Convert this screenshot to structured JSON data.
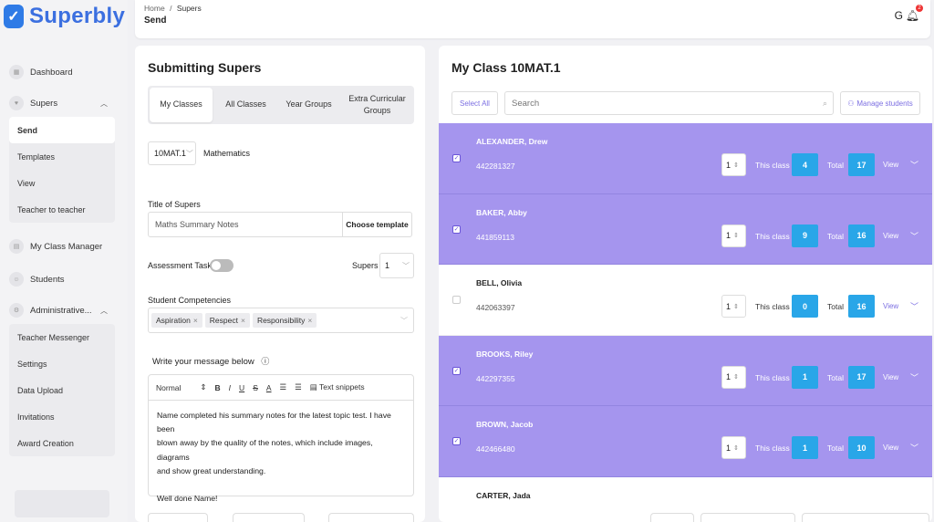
{
  "app": {
    "logo_text": "Superbly",
    "logo_mark": "✓"
  },
  "sidebar": {
    "items": [
      {
        "label": "Dashboard",
        "icon": "dashboard-icon"
      },
      {
        "label": "Supers",
        "icon": "heart-icon"
      },
      {
        "label": "My Class Manager",
        "icon": "clipboard-icon"
      },
      {
        "label": "Students",
        "icon": "users-icon"
      },
      {
        "label": "Administrative...",
        "icon": "gear-icon"
      }
    ],
    "supers_sub": [
      "Send",
      "Templates",
      "View",
      "Teacher to teacher"
    ],
    "admin_sub": [
      "Teacher Messenger",
      "Settings",
      "Data Upload",
      "Invitations",
      "Award Creation"
    ]
  },
  "header": {
    "breadcrumb_home": "Home",
    "breadcrumb_sep": "/",
    "breadcrumb_current": "Supers",
    "title": "Send",
    "notification_count": "2"
  },
  "submit": {
    "title": "Submitting Supers",
    "tabs": [
      "My Classes",
      "All Classes",
      "Year Groups",
      "Extra Curricular Groups"
    ],
    "class_value": "10MAT.1",
    "subject": "Mathematics",
    "title_label": "Title of Supers",
    "title_value": "Maths Summary Notes",
    "choose_template": "Choose template",
    "assessment_label": "Assessment Task",
    "supers_label": "Supers",
    "supers_value": "1",
    "competencies_label": "Student Competencies",
    "competencies": [
      "Aspiration",
      "Respect",
      "Responsibility"
    ],
    "message_label": "Write your message below",
    "toolbar": {
      "format": "Normal",
      "snippets": "Text snippets"
    },
    "message_lines": [
      "Name completed his summary notes for the latest topic test. I have been",
      "blown away by the quality of the notes, which include images, diagrams",
      "and show great understanding.",
      "",
      "Well done Name!"
    ]
  },
  "class_panel": {
    "title": "My Class 10MAT.1",
    "select_all": "Select All",
    "search_placeholder": "Search",
    "manage_students": "Manage students",
    "this_class_label": "This class",
    "total_label": "Total",
    "view_label": "View",
    "students": [
      {
        "name": "ALEXANDER, Drew",
        "id": "442281327",
        "selected": true,
        "qty": "1",
        "this_class": "4",
        "total": "17"
      },
      {
        "name": "BAKER, Abby",
        "id": "441859113",
        "selected": true,
        "qty": "1",
        "this_class": "9",
        "total": "16"
      },
      {
        "name": "BELL, Olivia",
        "id": "442063397",
        "selected": false,
        "qty": "1",
        "this_class": "0",
        "total": "16"
      },
      {
        "name": "BROOKS, Riley",
        "id": "442297355",
        "selected": true,
        "qty": "1",
        "this_class": "1",
        "total": "17"
      },
      {
        "name": "BROWN, Jacob",
        "id": "442466480",
        "selected": true,
        "qty": "1",
        "this_class": "1",
        "total": "10"
      },
      {
        "name": "CARTER, Jada",
        "id": "",
        "selected": false,
        "qty": "",
        "this_class": "",
        "total": ""
      }
    ]
  },
  "colors": {
    "accent": "#7c6fe2",
    "selected_row": "#a595ee",
    "count_badge": "#29a6e8",
    "logo": "#3b6fe0"
  }
}
